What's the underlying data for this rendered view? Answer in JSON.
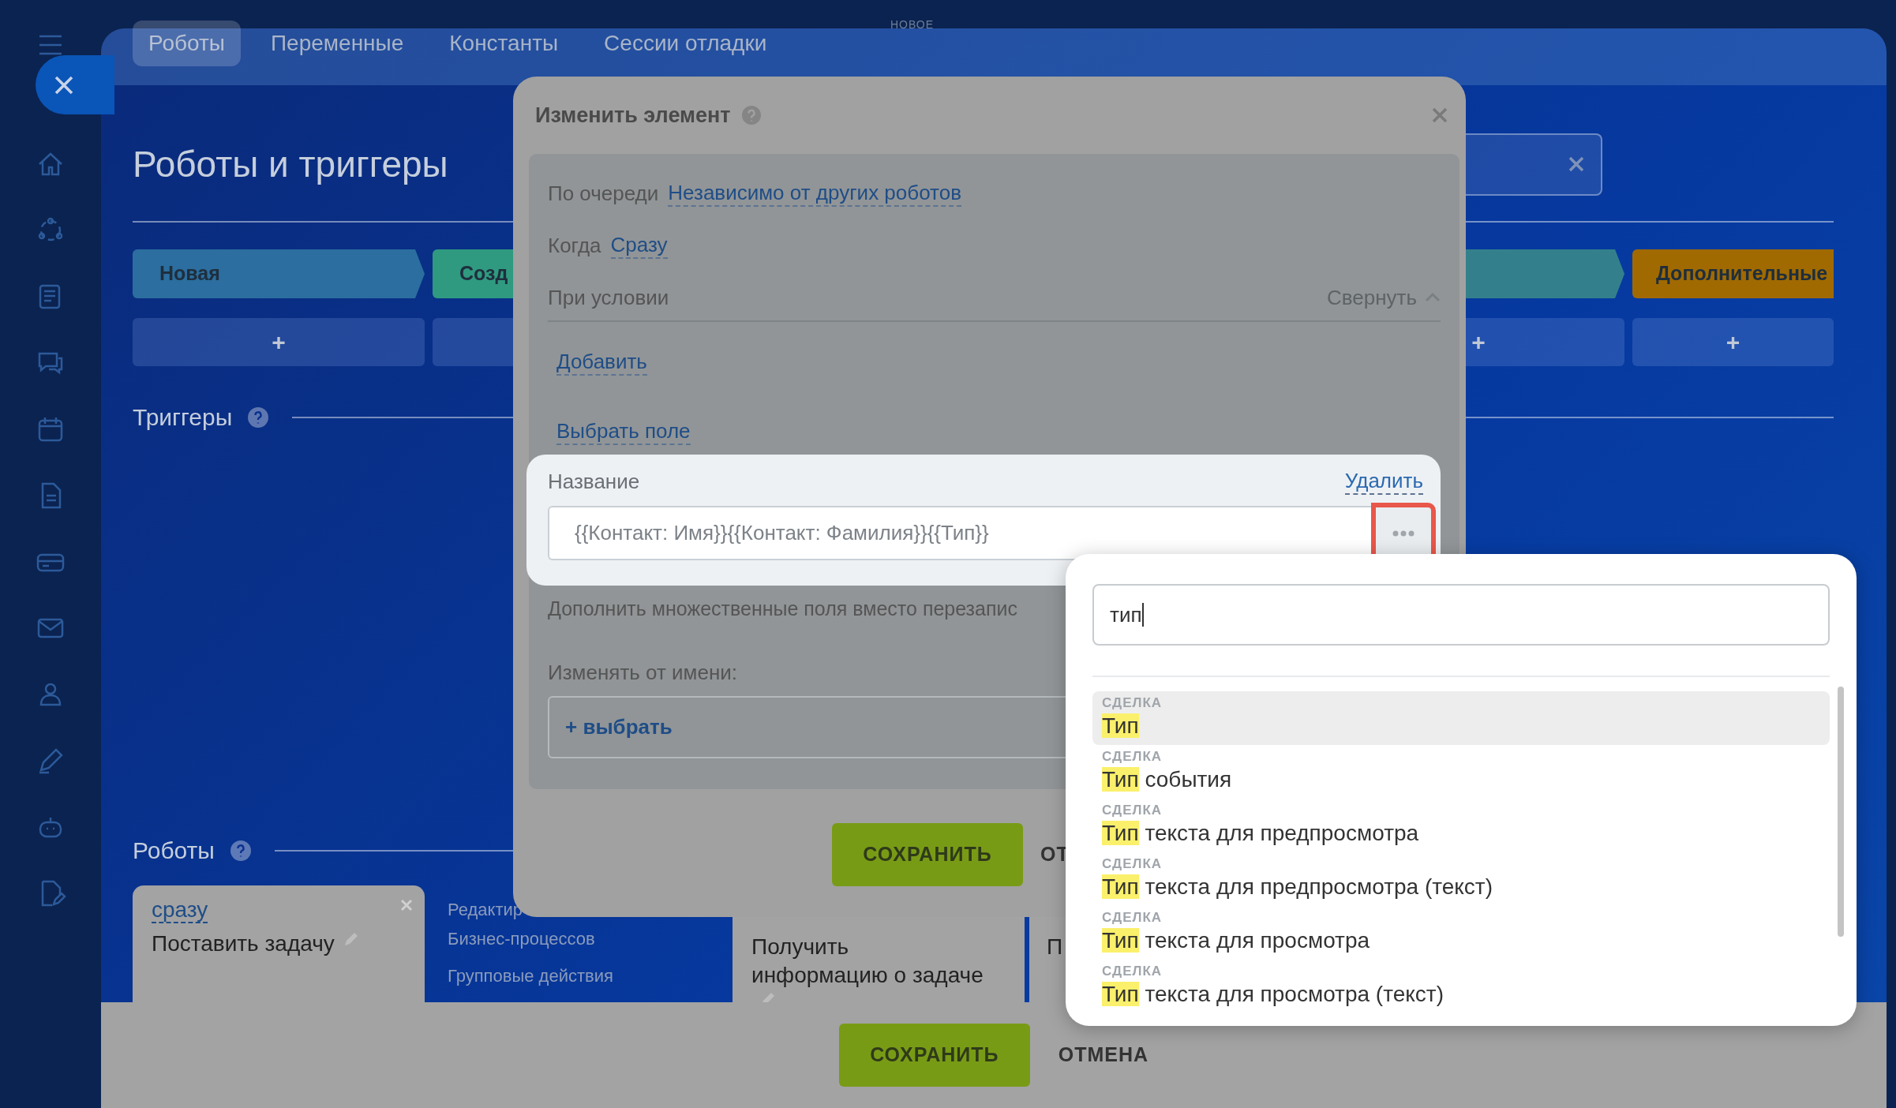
{
  "top_tabs": [
    {
      "label": "Роботы",
      "selected": true
    },
    {
      "label": "Переменные",
      "selected": false
    },
    {
      "label": "Константы",
      "selected": false
    },
    {
      "label": "Сессии отладки",
      "selected": false,
      "badge": "НОВОЕ"
    }
  ],
  "page_title": "Роботы и триггеры",
  "stages": [
    {
      "label": "Новая",
      "color": "#2b6e9f",
      "plus": "+"
    },
    {
      "label": "Созд",
      "color": "#2f9a80"
    },
    {
      "color": "#33808c",
      "plus": "+"
    },
    {
      "label": "Дополнительные",
      "color": "#a06a00",
      "plus": "+"
    }
  ],
  "triggers_heading": "Триггеры",
  "robots_heading": "Роботы",
  "robots": [
    {
      "kind": "card",
      "trigger": "сразу",
      "title": "Поставить задачу",
      "editable": true,
      "closable": true
    },
    {
      "kind": "menu",
      "items": [
        "Редактир",
        "Бизнес-процессов",
        "Групповые действия"
      ]
    },
    {
      "kind": "card",
      "title": "Получить информацию о задаче",
      "editable": true
    },
    {
      "kind": "card",
      "title": "П"
    }
  ],
  "bottom_buttons": [
    "СОХРАНИТЬ",
    "ОТМЕНА"
  ],
  "dialog": {
    "title": "Изменить элемент",
    "rows": [
      {
        "kind": "link_row",
        "label": "По очереди",
        "value": "Независимо от других роботов"
      },
      {
        "kind": "link_row",
        "label": "Когда",
        "value": "Сразу"
      },
      {
        "kind": "section",
        "label": "При условии",
        "action": "Свернуть"
      },
      {
        "kind": "link",
        "value": "Добавить"
      },
      {
        "kind": "link",
        "value": "Выбрать поле"
      },
      {
        "kind": "field",
        "label": "Название",
        "action": "Удалить",
        "value": "{{Контакт: Имя}}{{Контакт: Фамилия}}{{Тип}}",
        "more_highlighted": true
      },
      {
        "kind": "text",
        "label": "Дополнить множественные поля вместо перезапис"
      },
      {
        "kind": "picker",
        "label": "Изменять от имени:",
        "value": "+ выбрать"
      }
    ],
    "buttons": [
      "СОХРАНИТЬ",
      "ОТ"
    ]
  },
  "dropdown": {
    "query": "тип",
    "items": [
      {
        "group": "СДЕЛКА",
        "match": "Тип",
        "selected": true
      },
      {
        "group": "СДЕЛКА",
        "match": "Тип",
        "rest": " события",
        "selected": false
      },
      {
        "group": "СДЕЛКА",
        "match": "Тип",
        "rest": " текста для предпросмотра",
        "selected": false
      },
      {
        "group": "СДЕЛКА",
        "match": "Тип",
        "rest": " текста для предпросмотра (текст)",
        "selected": false
      },
      {
        "group": "СДЕЛКА",
        "match": "Тип",
        "rest": " текста для просмотра",
        "selected": false
      },
      {
        "group": "СДЕЛКА",
        "match": "Тип",
        "rest": " текста для просмотра (текст)",
        "selected": false
      }
    ]
  }
}
